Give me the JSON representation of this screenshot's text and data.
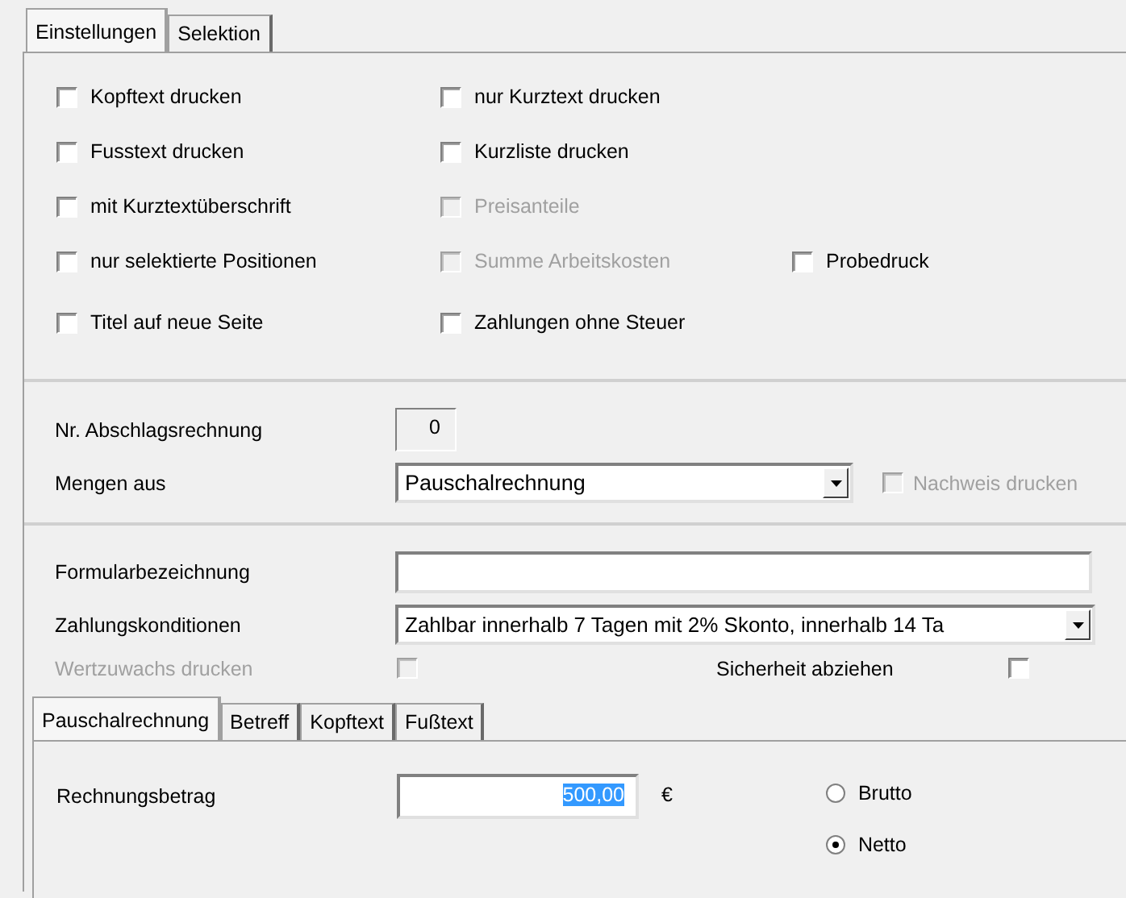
{
  "top_tabs": [
    {
      "label": "Einstellungen",
      "selected": true
    },
    {
      "label": "Selektion",
      "selected": false
    }
  ],
  "option_rows": [
    {
      "items": [
        {
          "label": "Kopftext drucken",
          "checked": false,
          "disabled": false
        },
        {
          "label": "nur Kurztext drucken",
          "checked": false,
          "disabled": false
        }
      ]
    },
    {
      "items": [
        {
          "label": "Fusstext drucken",
          "checked": false,
          "disabled": false
        },
        {
          "label": "Kurzliste drucken",
          "checked": false,
          "disabled": false
        }
      ]
    },
    {
      "items": [
        {
          "label": "mit Kurztextüberschrift",
          "checked": false,
          "disabled": false
        },
        {
          "label": "Preisanteile",
          "checked": false,
          "disabled": true
        }
      ]
    },
    {
      "items": [
        {
          "label": "nur selektierte Positionen",
          "checked": false,
          "disabled": false
        },
        {
          "label": "Summe Arbeitskosten",
          "checked": false,
          "disabled": true
        },
        {
          "label": "Probedruck",
          "checked": false,
          "disabled": false
        }
      ]
    },
    {
      "items": [
        {
          "label": "Titel auf neue Seite",
          "checked": false,
          "disabled": false
        },
        {
          "label": "Zahlungen ohne Steuer",
          "checked": false,
          "disabled": false
        }
      ]
    }
  ],
  "nr_abschlagsrechnung": {
    "label": "Nr. Abschlagsrechnung",
    "value": "0"
  },
  "mengen_aus": {
    "label": "Mengen aus",
    "value": "Pauschalrechnung"
  },
  "nachweis_drucken": {
    "label": "Nachweis drucken",
    "checked": false,
    "disabled": true
  },
  "formularbezeichnung": {
    "label": "Formularbezeichnung"
  },
  "zahlungskonditionen": {
    "label": "Zahlungskonditionen",
    "value": "Zahlbar innerhalb 7 Tagen mit 2% Skonto, innerhalb 14 Ta"
  },
  "wertzuwachs_drucken": {
    "label": "Wertzuwachs drucken",
    "checked": false,
    "disabled": true
  },
  "sicherheit_abziehen": {
    "label": "Sicherheit abziehen",
    "checked": false,
    "disabled": false
  },
  "bottom_tabs": [
    {
      "label": "Pauschalrechnung",
      "selected": true
    },
    {
      "label": "Betreff",
      "selected": false
    },
    {
      "label": "Kopftext",
      "selected": false
    },
    {
      "label": "Fußtext",
      "selected": false
    }
  ],
  "rechnungsbetrag": {
    "label": "Rechnungsbetrag",
    "value": "500,00",
    "text_selected": true,
    "currency": "€"
  },
  "price_mode": [
    {
      "label": "Brutto",
      "selected": false
    },
    {
      "label": "Netto",
      "selected": true
    }
  ]
}
